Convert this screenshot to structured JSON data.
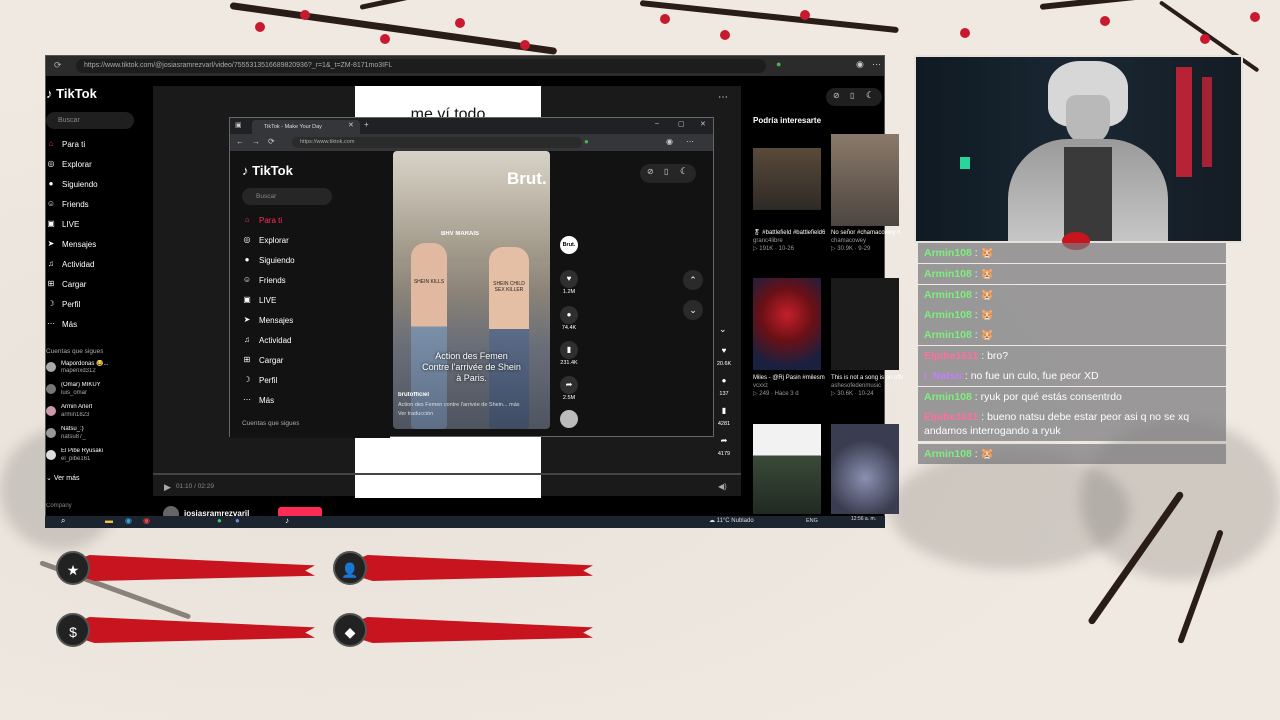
{
  "outer": {
    "url": "https://www.tiktok.com/@josiasramrezvarl/video/7555313516689820936?_r=1&_t=ZM-8171mo3IFL",
    "logo": "TikTok",
    "search_placeholder": "Buscar",
    "nav": [
      "Para ti",
      "Explorar",
      "Siguiendo",
      "Friends",
      "LIVE",
      "Mensajes",
      "Actividad",
      "Cargar",
      "Perfil",
      "Más"
    ],
    "following_header": "Cuentas que sigues",
    "following": [
      {
        "name": "Mapordonas 😂...",
        "handle": "mapenxd312"
      },
      {
        "name": "(Omar) MIKUY",
        "handle": "luis_omar"
      },
      {
        "name": "Armin Arlert",
        "handle": "armin1823"
      },
      {
        "name": "Natsu_:)",
        "handle": "natsu87_"
      },
      {
        "name": "El Pibe Ryusaki",
        "handle": "el_pibe161"
      }
    ],
    "see_more": "Ver más",
    "company": "Company",
    "video_caption": "me ví todo",
    "time": "01:10 / 02:29",
    "username_bottom": "josiasramrezvaril",
    "likes": "20.6K",
    "comments": "137",
    "saves": "4281",
    "shares": "4179",
    "right_header": "Podría interesarte",
    "cards": [
      {
        "title": "🎖 #battlefield #battlefield6 #fyp...",
        "author": "granc4libre",
        "meta": "▷ 191K · 10-26"
      },
      {
        "title": "No señor #chamacowey #...",
        "author": "chamacowey",
        "meta": "▷ 30.9K · 9-29"
      },
      {
        "title": "Miles - @Rj Pasin #milesmorales...",
        "author": "vcxxz",
        "meta": "▷ 249 · Hace 3 d"
      },
      {
        "title": "This is not a song is an offering.\"",
        "author": "ashesofedenmusic",
        "meta": "▷ 30.6K · 10-24"
      }
    ]
  },
  "inner": {
    "tab_title": "TikTok - Make Your Day",
    "url": "https://www.tiktok.com",
    "logo": "TikTok",
    "search_placeholder": "Buscar",
    "nav": [
      "Para ti",
      "Explorar",
      "Siguiendo",
      "Friends",
      "LIVE",
      "Mensajes",
      "Actividad",
      "Cargar",
      "Perfil",
      "Más"
    ],
    "following_header": "Cuentas que sigues",
    "brand": "Brut.",
    "overlay": "Action des Femen\nContre l'arrivée de Shein\nà Paris.",
    "author": "brutofficiel",
    "desc": "Action des Femen contre l'arrivée de Shein... más",
    "translate": "Ver traducción",
    "sign1": "SHEIN KILLS",
    "sign2": "SHEIN CHILD SEX KILLER",
    "store": "BHV MARAIS",
    "likes": "1.2M",
    "comments": "74.4K",
    "saves": "231.4K",
    "shares": "2.5M",
    "avatar_label": "Brut."
  },
  "taskbar": {
    "weather": "11°C Nublado",
    "lang": "ENG",
    "time": "12:56 a. m."
  },
  "chat": [
    {
      "user": "Armin108",
      "text": "🐹",
      "color": "green"
    },
    {
      "user": "Armin108",
      "text": "🐹",
      "color": "green"
    },
    {
      "user": "Armin108",
      "text": "🐹",
      "color": "green"
    },
    {
      "user": "Armin108",
      "text": "🐹",
      "color": "green"
    },
    {
      "user": "Armin108",
      "text": "🐹",
      "color": "green"
    },
    {
      "user": "Elpibe1611",
      "text": "bro?",
      "color": "pink"
    },
    {
      "user": "i_Natsu",
      "text": "no fue un culo, fue peor XD",
      "color": "purple"
    },
    {
      "user": "Armin108",
      "text": "ryuk por qué estás consentrdo",
      "color": "green"
    },
    {
      "user": "Elpibe1611",
      "text": "bueno natsu debe estar peor asi q no se xq andamos interrogando a ryuk",
      "color": "pink"
    },
    {
      "user": "Armin108",
      "text": "🐹",
      "color": "green"
    }
  ],
  "colors": {
    "accent": "#c8141f",
    "tiktok_pink": "#fe2c55"
  }
}
